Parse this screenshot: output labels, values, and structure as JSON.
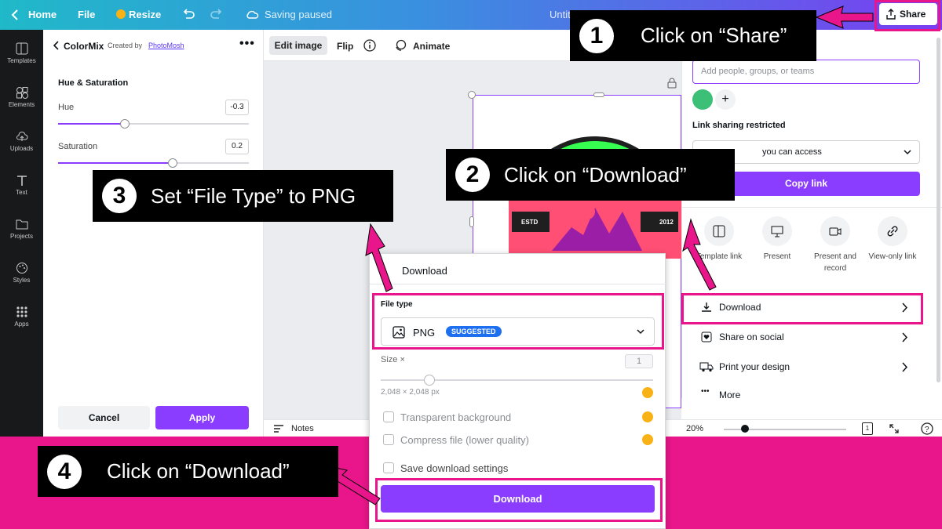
{
  "topbar": {
    "home": "Home",
    "file": "File",
    "resize": "Resize",
    "saving_status": "Saving paused",
    "doc_title": "Untit",
    "share": "Share"
  },
  "rail": [
    {
      "label": "Templates",
      "icon": "templates-icon"
    },
    {
      "label": "Elements",
      "icon": "elements-icon"
    },
    {
      "label": "Uploads",
      "icon": "uploads-icon"
    },
    {
      "label": "Text",
      "icon": "text-icon"
    },
    {
      "label": "Projects",
      "icon": "projects-icon"
    },
    {
      "label": "Styles",
      "icon": "styles-icon"
    },
    {
      "label": "Apps",
      "icon": "apps-icon"
    }
  ],
  "panel": {
    "title": "ColorMix",
    "created_by": "Created by",
    "author": "PhotoMosh",
    "section": "Hue & Saturation",
    "hue_label": "Hue",
    "hue_value": "-0.3",
    "hue_level": 0.35,
    "sat_label": "Saturation",
    "sat_value": "0.2",
    "sat_level": 0.6,
    "cancel": "Cancel",
    "apply": "Apply"
  },
  "canvas_toolbar": {
    "edit_image": "Edit image",
    "flip": "Flip",
    "animate": "Animate"
  },
  "logo": {
    "left_text": "ESTD",
    "right_text": "2012"
  },
  "bottombar": {
    "notes": "Notes",
    "zoom": "20%",
    "page": "1"
  },
  "share_panel": {
    "add_people_placeholder": "Add people, groups, or teams",
    "link_sharing": "Link sharing restricted",
    "access": "you can access",
    "copy_link": "Copy link",
    "options": [
      {
        "label": "Template link",
        "icon": "template-link-icon"
      },
      {
        "label": "Present",
        "icon": "present-icon"
      },
      {
        "label": "Present and record",
        "icon": "present-record-icon"
      },
      {
        "label": "View-only link",
        "icon": "view-only-link-icon"
      }
    ],
    "download": "Download",
    "share_social": "Share on social",
    "print": "Print your design",
    "more": "More"
  },
  "download_dialog": {
    "title": "Download",
    "file_type_label": "File type",
    "file_type_value": "PNG",
    "suggested_badge": "SUGGESTED",
    "size_label": "Size ×",
    "size_value": "1",
    "size_level": 0.18,
    "dimensions": "2,048 × 2,048 px",
    "transparent_bg": "Transparent background",
    "compress": "Compress file (lower quality)",
    "save_settings": "Save download settings",
    "download_button": "Download"
  },
  "callouts": {
    "c1_num": "1",
    "c1_text": "Click on “Share”",
    "c2_num": "2",
    "c2_text": "Click on “Download”",
    "c3_num": "3",
    "c3_text": "Set “File Type” to PNG",
    "c4_num": "4",
    "c4_text": "Click on “Download”"
  },
  "colors": {
    "accent": "#8b3dff",
    "highlight": "#e8168a",
    "suggested": "#1e6ff0"
  }
}
